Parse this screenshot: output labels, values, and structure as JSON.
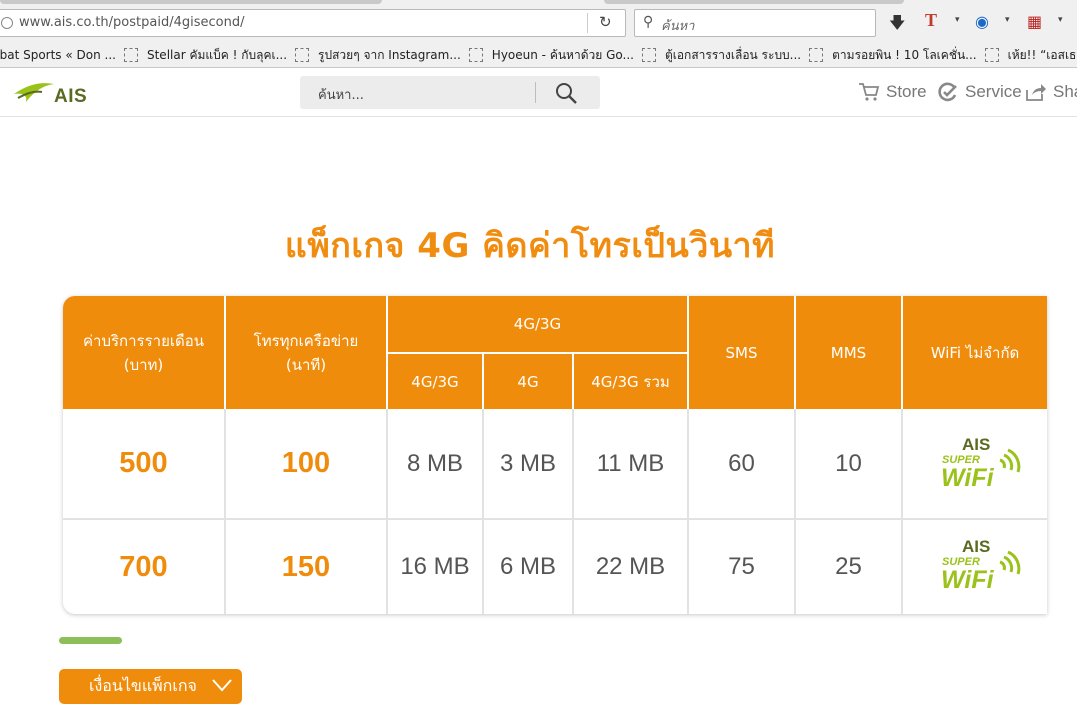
{
  "browser": {
    "url": "www.ais.co.th/postpaid/4gisecond/",
    "search_placeholder": "ค้นหา",
    "bookmarks": [
      "nbat Sports « Don ...",
      "Stellar คัมแบ็ค ! กับลุคเ...",
      "รูปสวยๆ จาก Instagram...",
      "Hyoeun - ค้นหาด้วย Go...",
      "ตู้เอกสารรางเลื่อน ระบบ...",
      "ตามรอยพิน ! 10 โลเคชั่น...",
      "เห้ย!! “เอสเธอร์” เธอเปลี่..."
    ]
  },
  "site": {
    "logo_text": "AIS",
    "search_placeholder": "ค้นหา...",
    "nav": {
      "store": "Store",
      "service": "Service",
      "share": "Sha"
    }
  },
  "content": {
    "title": "แพ็กเกจ 4G คิดค่าโทรเป็นวินาที",
    "table": {
      "headers": {
        "monthly_fee": "ค่าบริการรายเดือน (บาท)",
        "calls": "โทรทุกเครือข่าย (นาที)",
        "data_group": "4G/3G",
        "data_4g3g": "4G/3G",
        "data_4g": "4G",
        "data_total": "4G/3G รวม",
        "sms": "SMS",
        "mms": "MMS",
        "wifi": "WiFi ไม่จำกัด"
      },
      "rows": [
        {
          "fee": "500",
          "calls": "100",
          "data_4g3g": "8 MB",
          "data_4g": "3 MB",
          "data_total": "11 MB",
          "sms": "60",
          "mms": "10"
        },
        {
          "fee": "700",
          "calls": "150",
          "data_4g3g": "16 MB",
          "data_4g": "6 MB",
          "data_total": "22 MB",
          "sms": "75",
          "mms": "25"
        }
      ],
      "wifi_logo": {
        "top": "AIS",
        "middle": "SUPER",
        "bottom": "WiFi"
      }
    },
    "conditions_button": "เงื่อนไขแพ็กเกจ"
  },
  "colors": {
    "orange": "#f08c0c",
    "green_bar": "#8cbf5a",
    "wifi_green": "#9bc21a",
    "logo_olive": "#5a6a21"
  }
}
